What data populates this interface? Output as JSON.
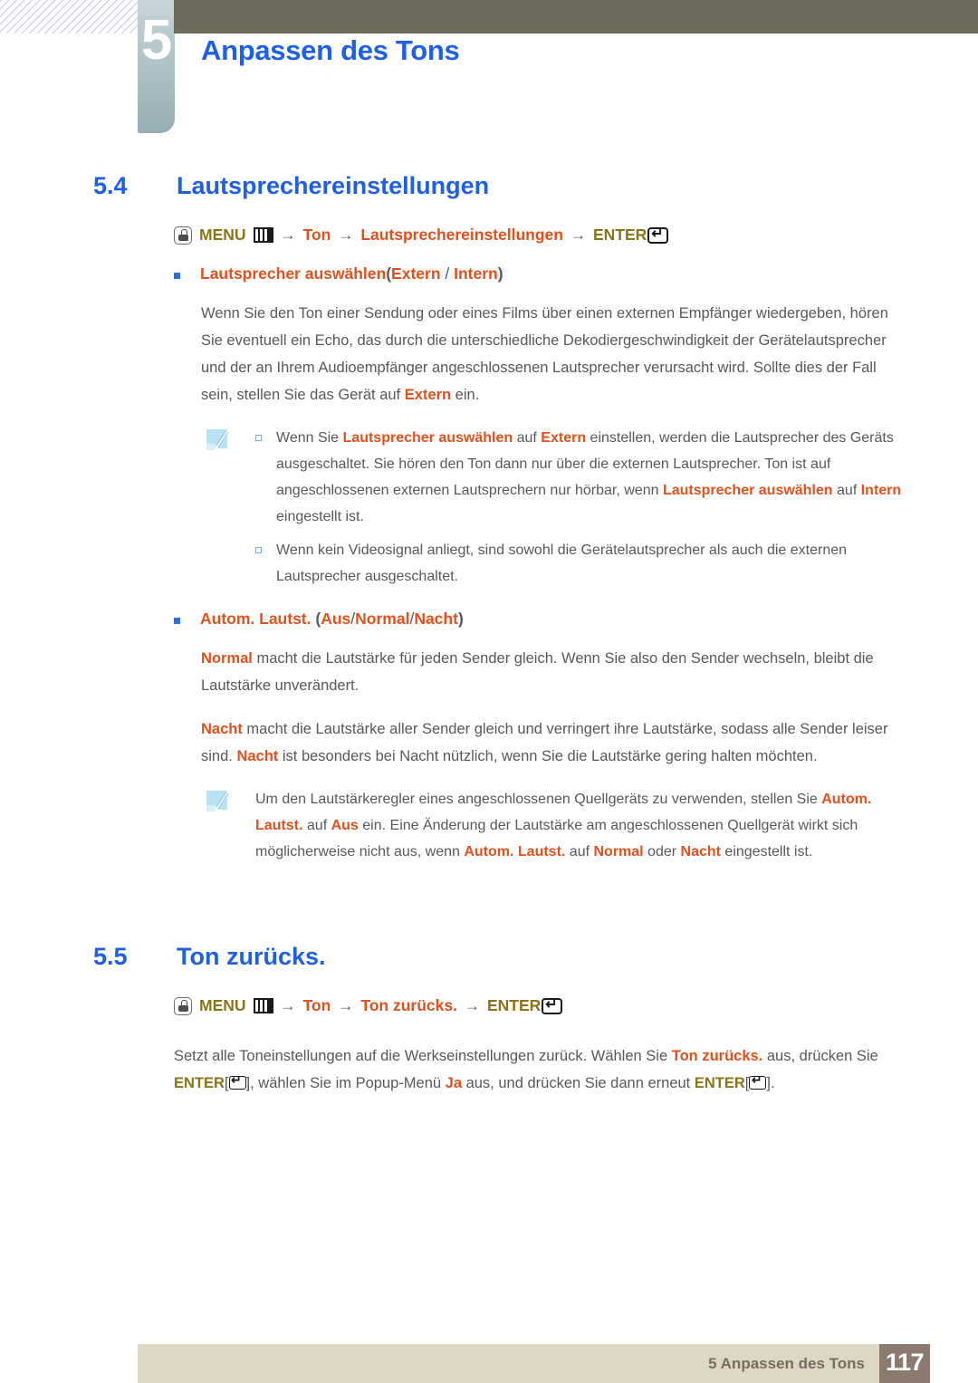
{
  "chapter": {
    "number": "5",
    "title": "Anpassen des Tons"
  },
  "sections": [
    {
      "number": "5.4",
      "title": "Lautsprechereinstellungen"
    },
    {
      "number": "5.5",
      "title": "Ton zurücks."
    }
  ],
  "nav_path_1": {
    "hand_icon": "hand-pointer-icon",
    "menu_label": "MENU",
    "menu_icon": "menu-bars-icon",
    "arrow": "→",
    "step1": "Ton",
    "step2": "Lautsprechereinstellungen",
    "enter_label": "ENTER",
    "enter_icon": "enter-return-icon"
  },
  "nav_path_2": {
    "hand_icon": "hand-pointer-icon",
    "menu_label": "MENU",
    "menu_icon": "menu-bars-icon",
    "arrow": "→",
    "step1": "Ton",
    "step2": "Ton zurücks.",
    "enter_label": "ENTER",
    "enter_icon": "enter-return-icon"
  },
  "bullet_speaker": {
    "label": "Lautsprecher auswählen",
    "open_paren": "(",
    "option1": "Extern",
    "slash": " / ",
    "option2": "Intern",
    "close_paren": ")"
  },
  "paragraph_speaker": {
    "part1": "Wenn Sie den Ton einer Sendung oder eines Films über einen externen Empfänger wiedergeben, hören Sie eventuell ein Echo, das durch die unterschiedliche Dekodiergeschwindigkeit der Gerätelautsprecher und der an Ihrem Audioempfänger angeschlossenen Lautsprecher verursacht wird. Sollte dies der Fall sein, stellen Sie das Gerät auf ",
    "hl1": "Extern",
    "part2": " ein."
  },
  "note_box_1": {
    "icon": "note-pencil-icon",
    "items": [
      {
        "p1": "Wenn Sie ",
        "h1": "Lautsprecher auswählen",
        "p2": " auf ",
        "h2": "Extern",
        "p3": " einstellen, werden die Lautsprecher des Geräts ausgeschaltet. Sie hören den Ton dann nur über die externen Lautsprecher. Ton ist auf angeschlossenen externen Lautsprechern nur hörbar, wenn ",
        "h3": "Lautsprecher auswählen",
        "p4": " auf ",
        "h4": "Intern",
        "p5": " eingestellt ist."
      },
      {
        "p1": "Wenn kein Videosignal anliegt, sind sowohl die Gerätelautsprecher als auch die externen Lautsprecher ausgeschaltet.",
        "h1": "",
        "p2": "",
        "h2": "",
        "p3": "",
        "h3": "",
        "p4": "",
        "h4": "",
        "p5": ""
      }
    ]
  },
  "bullet_autovolume": {
    "label": "Autom. Lautst.",
    "open_paren": "(",
    "option1": "Aus",
    "slash1": "/",
    "option2": "Normal",
    "slash2": "/",
    "option3": "Nacht",
    "close_paren": ")"
  },
  "paragraph_normal": {
    "hl1": "Normal",
    "part1": " macht die Lautstärke für jeden Sender gleich. Wenn Sie also den Sender wechseln, bleibt die Lautstärke unverändert."
  },
  "paragraph_nacht": {
    "hl1": "Nacht",
    "part1": " macht die Lautstärke aller Sender gleich und verringert ihre Lautstärke, sodass alle Sender leiser sind. ",
    "hl2": "Nacht",
    "part2": " ist besonders bei Nacht nützlich, wenn Sie die Lautstärke gering halten möchten."
  },
  "note_box_2": {
    "icon": "note-pencil-icon",
    "p1": "Um den Lautstärkeregler eines angeschlossenen Quellgeräts zu verwenden, stellen Sie ",
    "h1": "Autom. Lautst.",
    "p2": " auf ",
    "h2": "Aus",
    "p3": " ein. Eine Änderung der Lautstärke am angeschlossenen Quellgerät wirkt sich möglicherweise nicht aus, wenn ",
    "h3": "Autom. Lautst.",
    "p4": " auf ",
    "h4": "Normal",
    "p5": " oder ",
    "h5": "Nacht",
    "p6": " eingestellt ist."
  },
  "paragraph_reset": {
    "p1": "Setzt alle Toneinstellungen auf die Werkseinstellungen zurück. Wählen Sie ",
    "h1": "Ton zurücks.",
    "p2": " aus, drücken Sie ",
    "h2": "ENTER",
    "br1": "[",
    "br2": "]",
    "p3": ", wählen Sie im Popup-Menü ",
    "h3": "Ja",
    "p4": " aus, und drücken Sie dann erneut ",
    "h4": "ENTER",
    "br3": "[",
    "br4": "]",
    "p5": "."
  },
  "footer": {
    "text": "5 Anpassen des Tons",
    "page_number": "117"
  },
  "colors": {
    "heading_blue": "#1f5fe8",
    "highlight_orange": "#e2501b",
    "highlight_olive": "#8a7416",
    "body_gray": "#58585a",
    "chapter_bar_olive": "#6e6c5a",
    "footer_beige": "#ddd8c4",
    "footer_pagebox_brown": "#8c7a6e"
  }
}
